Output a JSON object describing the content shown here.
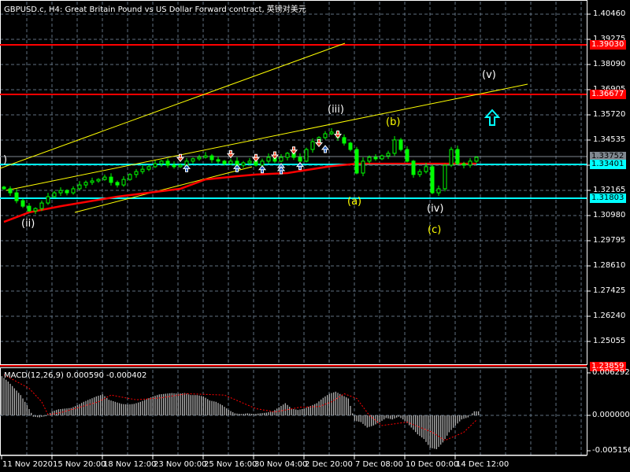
{
  "header": {
    "title": "GBPUSD.c, H4:  Great Britain Pound vs US Dollar Forward contract, 英镑对美元"
  },
  "colors": {
    "background": "#000000",
    "candle": "#00ff00",
    "ma": "#ff0000",
    "trendline": "#ffff00",
    "resistance": "#ff0000",
    "support": "#00ffff",
    "grid": "#5f7080",
    "macd_hist": "#c0c0c0",
    "macd_signal": "#ff0000"
  },
  "chart_data": [
    {
      "type": "candlestick",
      "title": "GBPUSD.c, H4",
      "ylim": [
        1.2387,
        1.4106
      ],
      "y_ticks": [
        "1.40460",
        "1.39275",
        "1.38090",
        "1.36905",
        "1.35720",
        "1.34535",
        "1.33350",
        "1.32165",
        "1.30980",
        "1.29795",
        "1.28610",
        "1.27425",
        "1.26240",
        "1.25055"
      ],
      "x_ticks": [
        "11 Nov 2020",
        "15 Nov 20:00",
        "18 Nov 12:00",
        "23 Nov 00:00",
        "25 Nov 16:00",
        "30 Nov 04:00",
        "2 Dec 20:00",
        "7 Dec 08:00",
        "10 Dec 00:00",
        "14 Dec 12:00"
      ],
      "closes": [
        1.3224,
        1.3205,
        1.3168,
        1.3142,
        1.312,
        1.3131,
        1.3157,
        1.3187,
        1.3205,
        1.3216,
        1.3205,
        1.3224,
        1.3242,
        1.3254,
        1.3261,
        1.3268,
        1.3279,
        1.3254,
        1.3242,
        1.3268,
        1.3291,
        1.3305,
        1.3316,
        1.3328,
        1.3342,
        1.3354,
        1.3335,
        1.3328,
        1.3335,
        1.3354,
        1.3365,
        1.3372,
        1.3379,
        1.3361,
        1.3354,
        1.3342,
        1.3354,
        1.3335,
        1.3346,
        1.3354,
        1.3335,
        1.3354,
        1.3372,
        1.3354,
        1.3372,
        1.3391,
        1.3372,
        1.3354,
        1.3409,
        1.3446,
        1.3465,
        1.3483,
        1.3491,
        1.3465,
        1.3439,
        1.3409,
        1.3298,
        1.3354,
        1.3372,
        1.3365,
        1.3379,
        1.3391,
        1.3454,
        1.3409,
        1.3354,
        1.3291,
        1.3305,
        1.3328,
        1.3205,
        1.3224,
        1.3335,
        1.3409,
        1.3342,
        1.3335,
        1.3354,
        1.3372
      ],
      "moving_average": [
        [
          0,
          1.3068
        ],
        [
          4,
          1.3113
        ],
        [
          9,
          1.3142
        ],
        [
          18,
          1.3187
        ],
        [
          28,
          1.3224
        ],
        [
          32,
          1.3268
        ],
        [
          37,
          1.3283
        ],
        [
          40,
          1.3291
        ],
        [
          45,
          1.3298
        ],
        [
          52,
          1.3331
        ],
        [
          56,
          1.3342
        ],
        [
          75,
          1.3342
        ]
      ],
      "horizontal_levels": [
        {
          "price": "1.39030",
          "color": "#ff0000"
        },
        {
          "price": "1.36677",
          "color": "#ff0000"
        },
        {
          "price": "1.33752",
          "color": "#808890"
        },
        {
          "price": "1.33401",
          "color": "#00ffff"
        },
        {
          "price": "1.31803",
          "color": "#00ffff"
        }
      ],
      "current_low_tag": "1.23859",
      "wave_labels": [
        {
          "text": ")",
          "color": "#ffffff"
        },
        {
          "text": "(ii)",
          "color": "#ffffff"
        },
        {
          "text": "(iii)",
          "color": "#ffffff"
        },
        {
          "text": "(a)",
          "color": "#ffff00"
        },
        {
          "text": "(b)",
          "color": "#ffff00"
        },
        {
          "text": "(iv)",
          "color": "#ffffff"
        },
        {
          "text": "(c)",
          "color": "#ffff00"
        },
        {
          "text": "(v)",
          "color": "#ffffff"
        }
      ]
    },
    {
      "type": "bar",
      "title": "MACD(12,26,9) 0.000590 -0.000402",
      "units": "1e-3",
      "ylim": [
        -5.156,
        6.292
      ],
      "y_ticks": [
        "0.006292",
        "0.000000",
        "-0.005156"
      ],
      "histogram": [
        5.8,
        5.0,
        4.0,
        3.0,
        1.5,
        -0.2,
        -0.3,
        -0.1,
        0.6,
        0.9,
        1.0,
        1.1,
        1.5,
        2.0,
        2.4,
        2.8,
        3.1,
        2.3,
        2.0,
        1.7,
        1.6,
        1.7,
        2.0,
        2.4,
        2.8,
        3.1,
        3.2,
        3.3,
        3.2,
        3.3,
        3.0,
        3.0,
        2.8,
        2.2,
        2.0,
        1.5,
        0.8,
        0.3,
        0.2,
        0.3,
        0.2,
        0.3,
        0.4,
        0.6,
        1.2,
        1.8,
        1.0,
        0.8,
        1.0,
        1.4,
        1.8,
        2.6,
        3.2,
        3.5,
        3.0,
        2.5,
        -0.8,
        -1.0,
        -1.8,
        -1.5,
        -1.0,
        -0.4,
        -0.6,
        -0.2,
        -0.8,
        -1.8,
        -2.8,
        -3.5,
        -4.8,
        -5.0,
        -4.0,
        -2.5,
        -1.5,
        -0.6,
        -0.3,
        0.6
      ],
      "signal": [
        [
          0,
          6.0
        ],
        [
          4,
          4.0
        ],
        [
          6,
          2.0
        ],
        [
          7,
          0.1
        ],
        [
          9,
          0.4
        ],
        [
          12,
          1.2
        ],
        [
          15,
          2.0
        ],
        [
          17,
          3.0
        ],
        [
          21,
          2.3
        ],
        [
          25,
          2.6
        ],
        [
          29,
          3.2
        ],
        [
          35,
          3.0
        ],
        [
          40,
          1.0
        ],
        [
          43,
          0.5
        ],
        [
          47,
          1.2
        ],
        [
          50,
          1.3
        ],
        [
          52,
          2.0
        ],
        [
          54,
          3.2
        ],
        [
          56,
          2.5
        ],
        [
          58,
          0.0
        ],
        [
          60,
          -1.5
        ],
        [
          64,
          -1.0
        ],
        [
          68,
          -2.5
        ],
        [
          70,
          -3.7
        ],
        [
          73,
          -2.5
        ],
        [
          75,
          -0.7
        ]
      ]
    }
  ]
}
